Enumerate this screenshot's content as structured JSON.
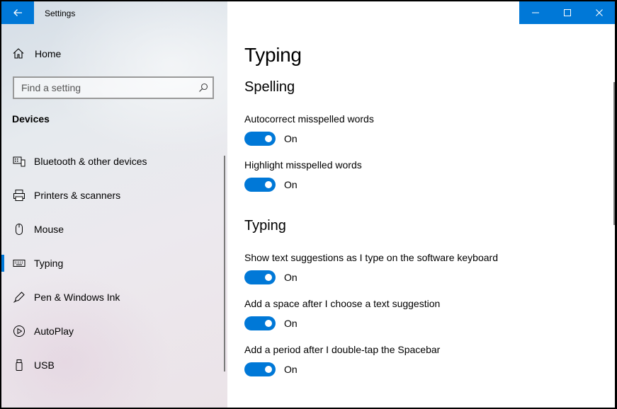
{
  "window": {
    "title": "Settings"
  },
  "sidebar": {
    "home_label": "Home",
    "search_placeholder": "Find a setting",
    "section_title": "Devices",
    "items": [
      {
        "label": "Bluetooth & other devices",
        "icon": "bluetooth-devices-icon"
      },
      {
        "label": "Printers & scanners",
        "icon": "printer-icon"
      },
      {
        "label": "Mouse",
        "icon": "mouse-icon"
      },
      {
        "label": "Typing",
        "icon": "keyboard-icon",
        "selected": true
      },
      {
        "label": "Pen & Windows Ink",
        "icon": "pen-icon"
      },
      {
        "label": "AutoPlay",
        "icon": "autoplay-icon"
      },
      {
        "label": "USB",
        "icon": "usb-icon"
      }
    ]
  },
  "content": {
    "page_title": "Typing",
    "spelling": {
      "title": "Spelling",
      "settings": [
        {
          "label": "Autocorrect misspelled words",
          "state": "On"
        },
        {
          "label": "Highlight misspelled words",
          "state": "On"
        }
      ]
    },
    "typing": {
      "title": "Typing",
      "settings": [
        {
          "label": "Show text suggestions as I type on the software keyboard",
          "state": "On"
        },
        {
          "label": "Add a space after I choose a text suggestion",
          "state": "On"
        },
        {
          "label": "Add a period after I double-tap the Spacebar",
          "state": "On"
        }
      ]
    }
  },
  "colors": {
    "accent": "#0078d7"
  }
}
